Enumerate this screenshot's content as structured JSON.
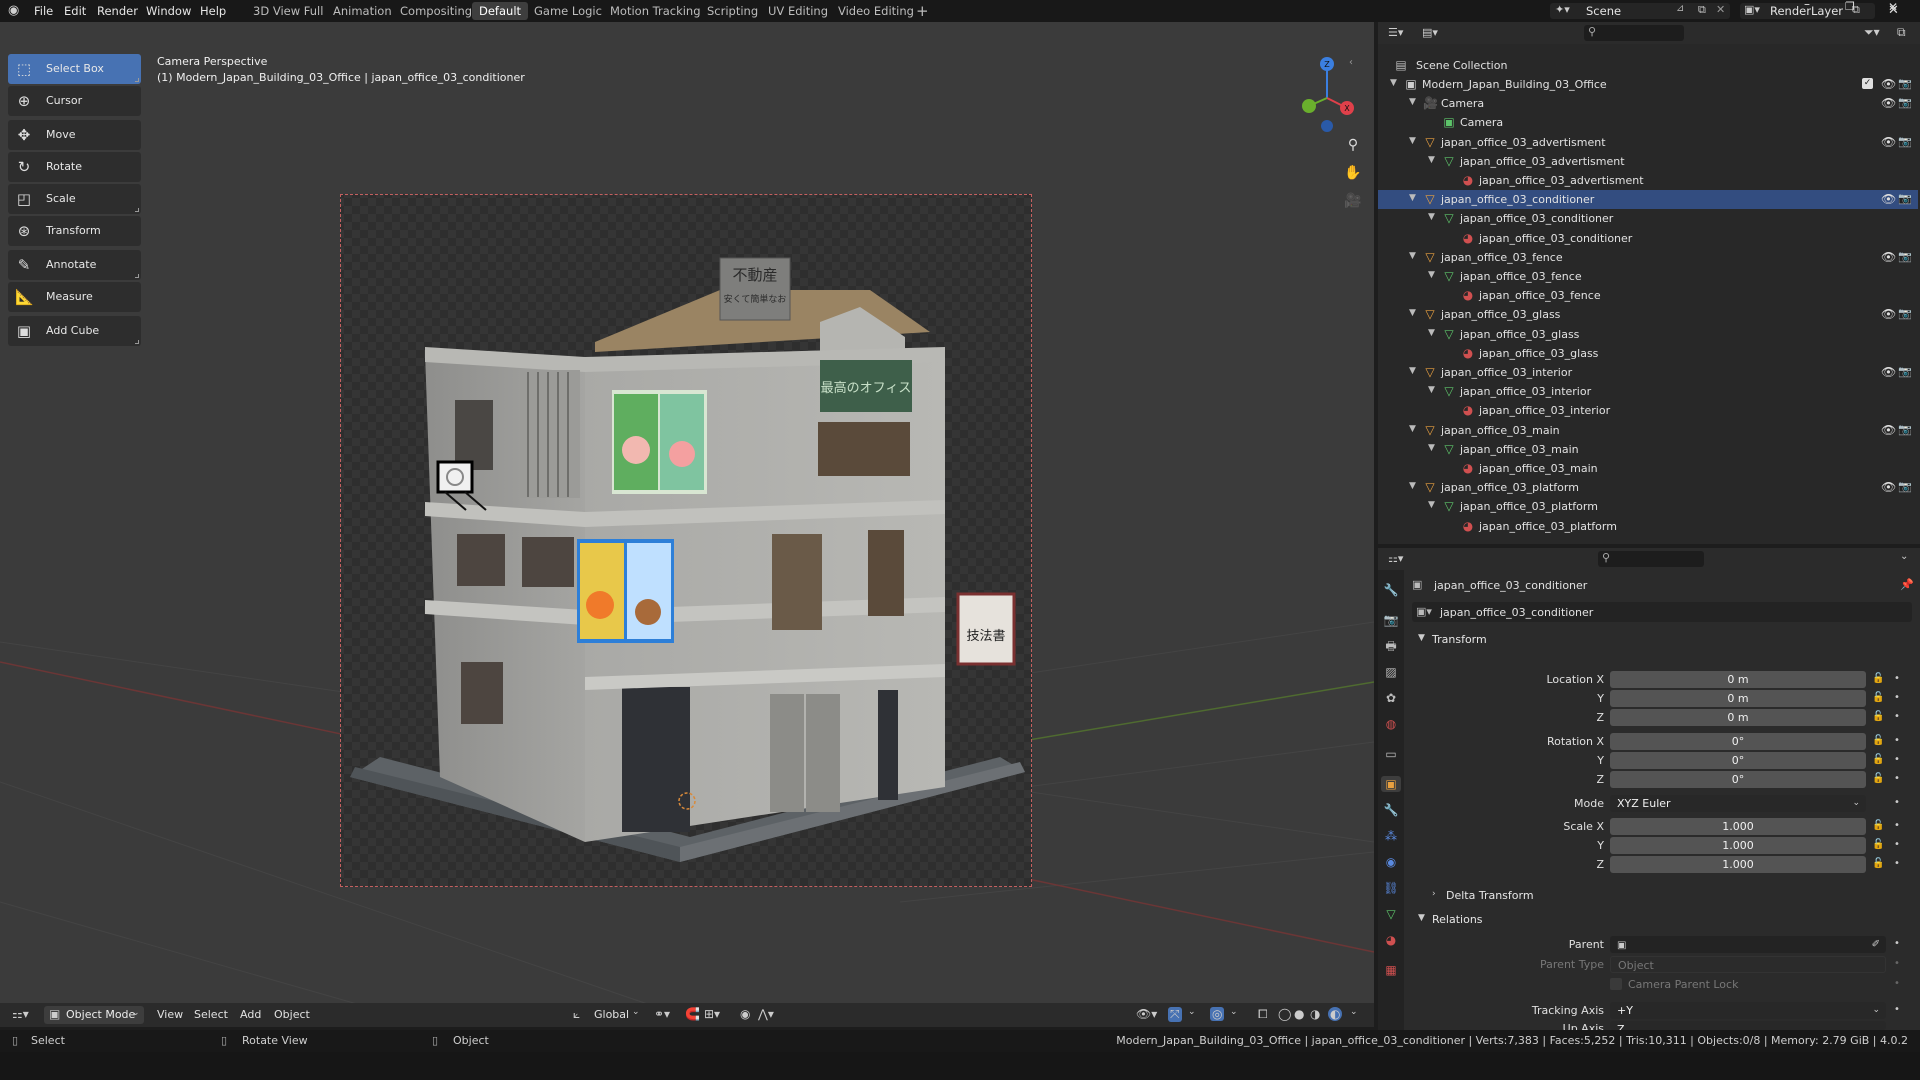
{
  "topbar": {
    "menus": [
      "File",
      "Edit",
      "Render",
      "Window",
      "Help"
    ],
    "workspaces": [
      "3D View Full",
      "Animation",
      "Compositing",
      "Default",
      "Game Logic",
      "Motion Tracking",
      "Scripting",
      "UV Editing",
      "Video Editing"
    ],
    "active_workspace": "Default",
    "scene": "Scene",
    "render_layer": "RenderLayer"
  },
  "viewport": {
    "view_name": "Camera Perspective",
    "view_context": "(1) Modern_Japan_Building_03_Office | japan_office_03_conditioner",
    "tools": [
      {
        "label": "Select Box",
        "icon": "select-box-icon"
      },
      {
        "label": "Cursor",
        "icon": "cursor-icon"
      },
      {
        "label": "Move",
        "icon": "move-icon"
      },
      {
        "label": "Rotate",
        "icon": "rotate-icon"
      },
      {
        "label": "Scale",
        "icon": "scale-icon"
      },
      {
        "label": "Transform",
        "icon": "transform-icon"
      },
      {
        "label": "Annotate",
        "icon": "annotate-icon"
      },
      {
        "label": "Measure",
        "icon": "measure-icon"
      },
      {
        "label": "Add Cube",
        "icon": "add-cube-icon"
      }
    ],
    "header": {
      "mode": "Object Mode",
      "menus": [
        "View",
        "Select",
        "Add",
        "Object"
      ],
      "orientation": "Global"
    },
    "sign_top": [
      "不動産",
      "安くて簡単なお"
    ],
    "sign_office": "最高のオフィス",
    "sign_side": "技法書",
    "gizmo_axis_z": "Z",
    "gizmo_axis_x": "X"
  },
  "outliner": {
    "root": "Scene Collection",
    "rows": [
      {
        "label": "Modern_Japan_Building_03_Office",
        "level": 1,
        "type": "collection",
        "expanded": true,
        "checkbox": true
      },
      {
        "label": "Camera",
        "level": 2,
        "type": "camera-object",
        "expanded": true
      },
      {
        "label": "Camera",
        "level": 3,
        "type": "camera-data"
      },
      {
        "label": "japan_office_03_advertisment",
        "level": 2,
        "type": "object",
        "expanded": true
      },
      {
        "label": "japan_office_03_advertisment",
        "level": 3,
        "type": "mesh",
        "expanded": true
      },
      {
        "label": "japan_office_03_advertisment",
        "level": 4,
        "type": "material"
      },
      {
        "label": "japan_office_03_conditioner",
        "level": 2,
        "type": "object",
        "expanded": true,
        "active": true
      },
      {
        "label": "japan_office_03_conditioner",
        "level": 3,
        "type": "mesh",
        "expanded": true
      },
      {
        "label": "japan_office_03_conditioner",
        "level": 4,
        "type": "material"
      },
      {
        "label": "japan_office_03_fence",
        "level": 2,
        "type": "object",
        "expanded": true
      },
      {
        "label": "japan_office_03_fence",
        "level": 3,
        "type": "mesh",
        "expanded": true
      },
      {
        "label": "japan_office_03_fence",
        "level": 4,
        "type": "material"
      },
      {
        "label": "japan_office_03_glass",
        "level": 2,
        "type": "object",
        "expanded": true
      },
      {
        "label": "japan_office_03_glass",
        "level": 3,
        "type": "mesh",
        "expanded": true
      },
      {
        "label": "japan_office_03_glass",
        "level": 4,
        "type": "material"
      },
      {
        "label": "japan_office_03_interior",
        "level": 2,
        "type": "object",
        "expanded": true
      },
      {
        "label": "japan_office_03_interior",
        "level": 3,
        "type": "mesh",
        "expanded": true
      },
      {
        "label": "japan_office_03_interior",
        "level": 4,
        "type": "material"
      },
      {
        "label": "japan_office_03_main",
        "level": 2,
        "type": "object",
        "expanded": true
      },
      {
        "label": "japan_office_03_main",
        "level": 3,
        "type": "mesh",
        "expanded": true
      },
      {
        "label": "japan_office_03_main",
        "level": 4,
        "type": "material"
      },
      {
        "label": "japan_office_03_platform",
        "level": 2,
        "type": "object",
        "expanded": true
      },
      {
        "label": "japan_office_03_platform",
        "level": 3,
        "type": "mesh",
        "expanded": true
      },
      {
        "label": "japan_office_03_platform",
        "level": 4,
        "type": "material"
      }
    ]
  },
  "properties": {
    "object_name": "japan_office_03_conditioner",
    "object_field": "japan_office_03_conditioner",
    "transform_label": "Transform",
    "location_label": "Location X",
    "rotation_label": "Rotation X",
    "scale_label": "Scale X",
    "y_label": "Y",
    "z_label": "Z",
    "location": [
      "0 m",
      "0 m",
      "0 m"
    ],
    "rotation": [
      "0°",
      "0°",
      "0°"
    ],
    "mode_label": "Mode",
    "mode_value": "XYZ Euler",
    "scale": [
      "1.000",
      "1.000",
      "1.000"
    ],
    "delta_transform": "Delta Transform",
    "relations": "Relations",
    "parent_label": "Parent",
    "parent_value": "",
    "parent_type_label": "Parent Type",
    "parent_type_value": "Object",
    "camera_parent_lock": "Camera Parent Lock",
    "tracking_axis_label": "Tracking Axis",
    "tracking_axis_value": "+Y",
    "up_axis_label": "Up Axis",
    "up_axis_value": "Z"
  },
  "statusbar": {
    "select": "Select",
    "rotate_view": "Rotate View",
    "object": "Object",
    "stats": "Modern_Japan_Building_03_Office | japan_office_03_conditioner | Verts:7,383 | Faces:5,252 | Tris:10,311 | Objects:0/8 | Memory: 2.79 GiB | 4.0.2"
  },
  "colors": {
    "accent": "#4772b3",
    "selected_row": "#334d80",
    "object_icon": "#e8a040",
    "mesh_icon": "#5dc46a",
    "material_icon": "#d05050",
    "axis_x": "#e0404a",
    "axis_y": "#6aaf2d",
    "axis_z": "#3b7fe0"
  }
}
